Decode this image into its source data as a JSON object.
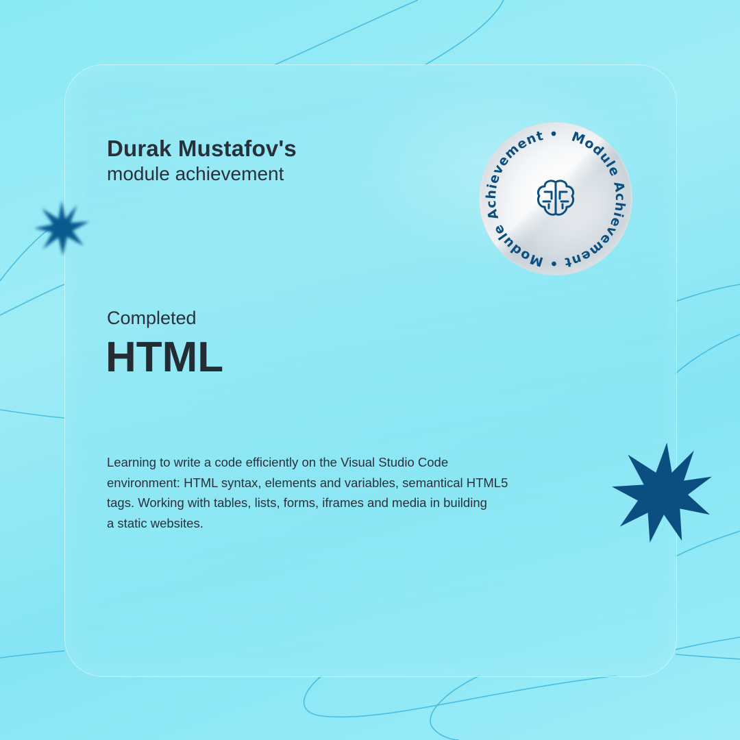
{
  "owner": {
    "name": "Durak Mustafov's",
    "subtitle": "module achievement"
  },
  "achievement": {
    "status": "Completed",
    "module": "HTML",
    "description_lines": [
      "Learning to write a code efficiently on the Visual Studio Code",
      "environment: HTML syntax, elements and variables, semantical HTML5",
      "tags. Working with tables, lists, forms, iframes and media in building",
      "a static websites."
    ]
  },
  "badge": {
    "ring_text": "Module Achievement",
    "separator": "•",
    "icon": "brain-circuit-icon"
  },
  "colors": {
    "accent": "#0a4f80",
    "text": "#28313b",
    "line": "#3cb4dc"
  }
}
